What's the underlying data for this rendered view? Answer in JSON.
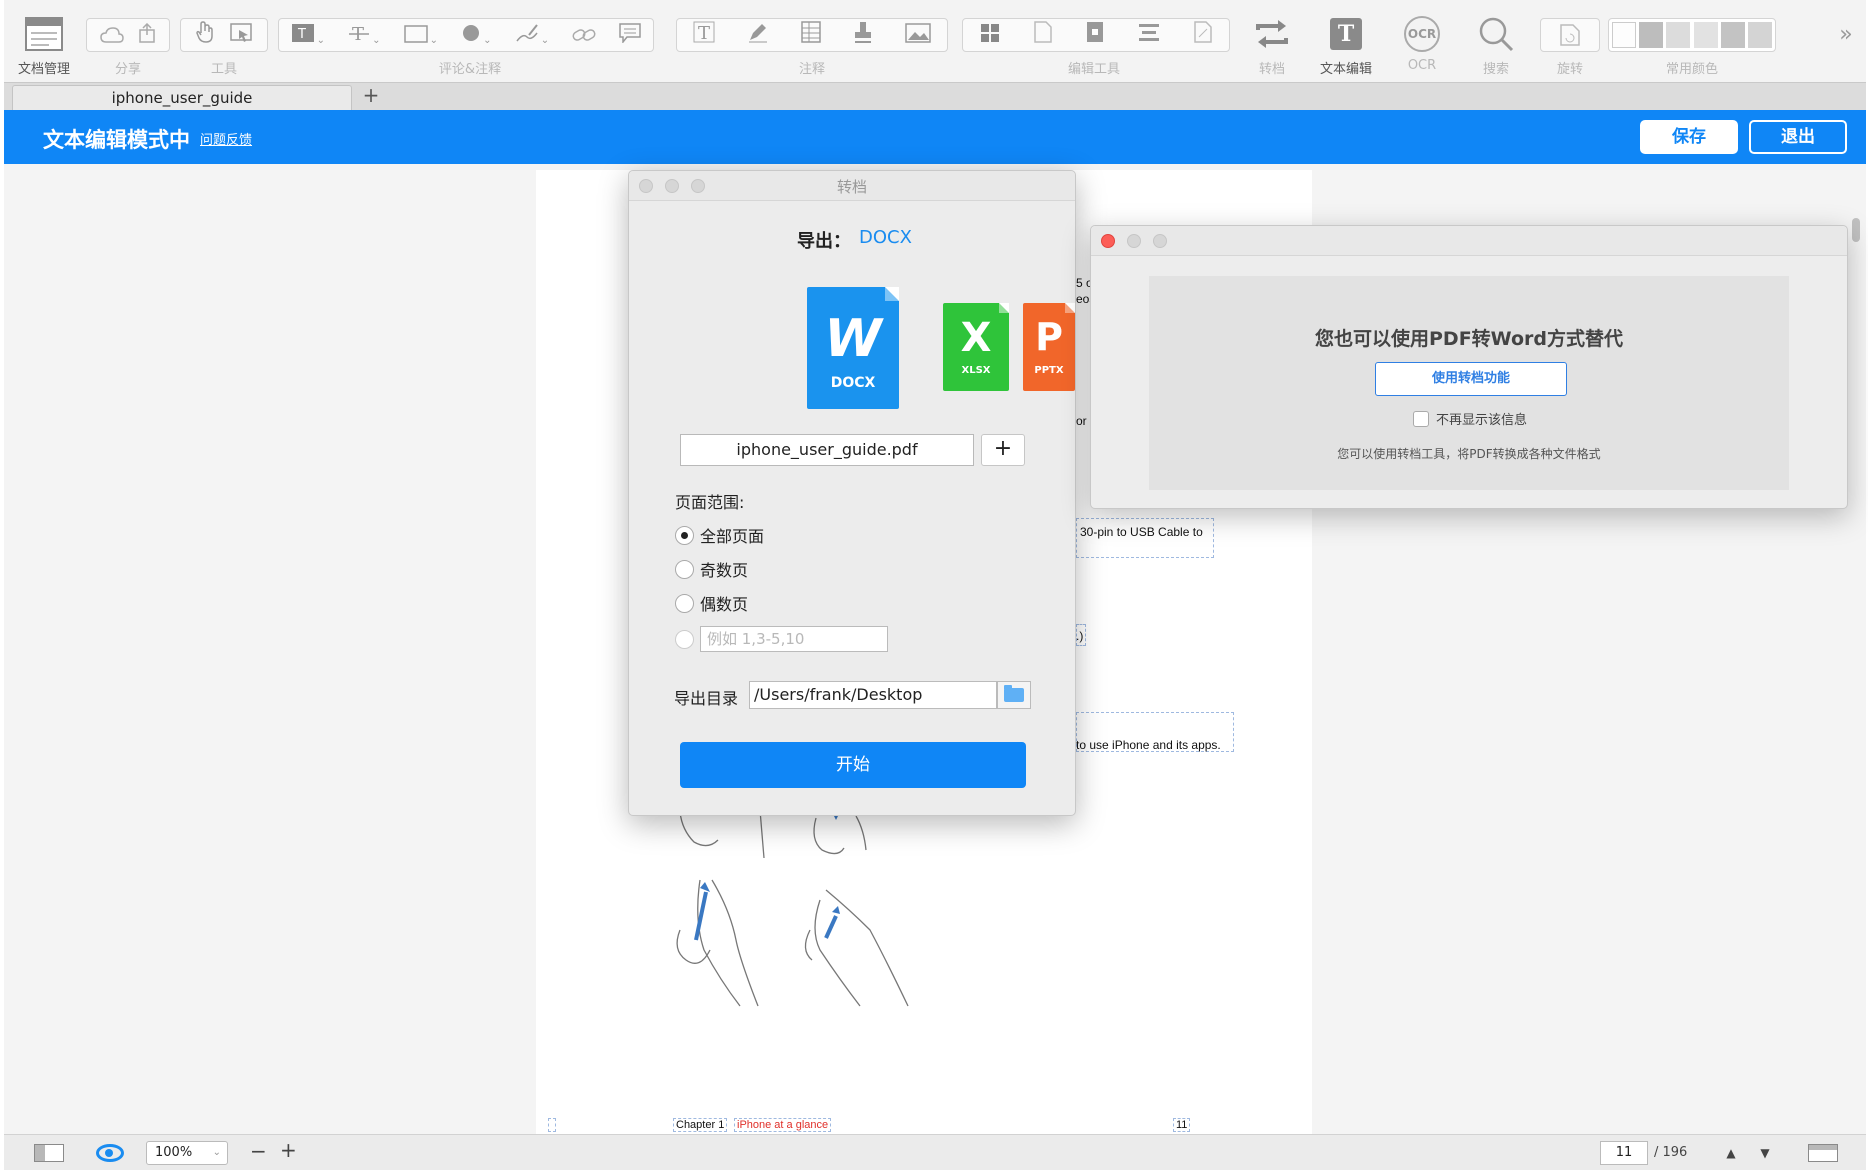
{
  "toolbar": {
    "labels": {
      "doc_manage": "文档管理",
      "share": "分享",
      "tools": "工具",
      "comment": "评论&注释",
      "annotate": "注释",
      "edit_tools": "编辑工具",
      "convert": "转档",
      "text_edit": "文本编辑",
      "ocr": "OCR",
      "search": "搜索",
      "rotate": "旋转",
      "colors": "常用颜色"
    },
    "icons": {
      "doc_manage": "document-manager-icon",
      "cloud": "cloud-icon",
      "share": "share-icon",
      "hand": "hand-tool-icon",
      "select": "select-tool-icon",
      "text_box": "text-box-icon",
      "strikethrough": "strikethrough-icon",
      "rectangle": "rectangle-icon",
      "circle": "circle-icon",
      "pen": "pen-icon",
      "link": "link-icon",
      "note": "note-icon",
      "typewriter": "typewriter-icon",
      "highlight": "highlight-pen-icon",
      "table": "table-icon",
      "stamp": "stamp-icon",
      "image": "image-icon",
      "grid": "grid-icon",
      "convert": "convert-arrows-icon",
      "text_edit": "text-edit-icon",
      "ocr": "ocr-icon",
      "search": "search-icon",
      "rotate": "rotate-icon",
      "more": "chevron-double-right-icon"
    },
    "glyphs": {
      "text_edit": "T",
      "ocr": "OCR",
      "more": "»"
    }
  },
  "tabs": {
    "active": "iphone_user_guide",
    "add": "+"
  },
  "editbar": {
    "title": "文本编辑模式中",
    "feedback": "问题反馈",
    "save": "保存",
    "exit": "退出",
    "color": "#0f86f6"
  },
  "pdf_page": {
    "fragments": [
      "5 o",
      "eos",
      "or t",
      "30-pin to USB Cable to",
      ".)",
      "to use iPhone and its apps."
    ],
    "footer": {
      "chapter": "Chapter  1",
      "section": "iPhone at a glance",
      "page_number": "11"
    }
  },
  "convert_dialog": {
    "title": "转档",
    "export_label": "导出：",
    "export_format": "DOCX",
    "formats": [
      {
        "letter": "W",
        "name": "DOCX",
        "color": "#1a93ee"
      },
      {
        "letter": "X",
        "name": "XLSX",
        "color": "#2fc43a"
      },
      {
        "letter": "P",
        "name": "PPTX",
        "color": "#f1662a"
      }
    ],
    "filename": "iphone_user_guide.pdf",
    "add_button": "+",
    "range_title": "页面范围:",
    "range_options": [
      {
        "label": "全部页面",
        "selected": true
      },
      {
        "label": "奇数页",
        "selected": false
      },
      {
        "label": "偶数页",
        "selected": false
      }
    ],
    "custom_range_placeholder": "例如 1,3-5,10",
    "dir_label": "导出目录",
    "dir_value": "/Users/frank/Desktop",
    "start": "开始"
  },
  "tip_popup": {
    "heading": "您也可以使用PDF转Word方式替代",
    "button": "使用转档功能",
    "checkbox_label": "不再显示该信息",
    "description": "您可以使用转档工具，将PDF转换成各种文件格式"
  },
  "statusbar": {
    "zoom": "100%",
    "zoom_minus": "−",
    "zoom_plus": "+",
    "current_page": "11",
    "total_pages": "/ 196",
    "prev": "▲",
    "next": "▼"
  }
}
